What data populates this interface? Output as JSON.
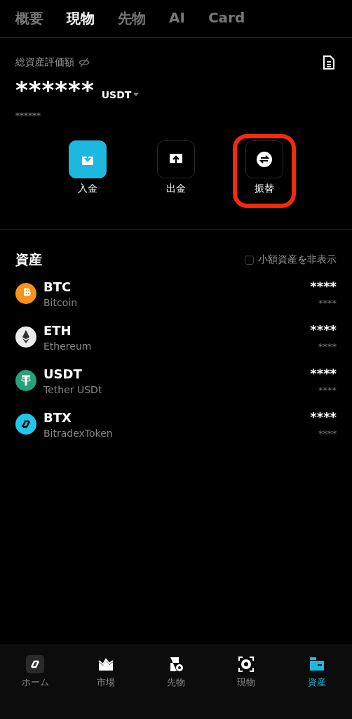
{
  "tabs": [
    {
      "label": "概要",
      "selected": false
    },
    {
      "label": "現物",
      "selected": true
    },
    {
      "label": "先物",
      "selected": false
    },
    {
      "label": "AI",
      "selected": false
    },
    {
      "label": "Card",
      "selected": false
    }
  ],
  "summary": {
    "label": "総資産評価額",
    "balance": "******",
    "currency": "USDT",
    "sub_balance": "******"
  },
  "actions": [
    {
      "kind": "deposit",
      "label": "入金",
      "highlighted": false
    },
    {
      "kind": "withdraw",
      "label": "出金",
      "highlighted": false
    },
    {
      "kind": "transfer",
      "label": "振替",
      "highlighted": true
    }
  ],
  "assets": {
    "title": "資産",
    "hide_small": {
      "label": "小額資産を非表示",
      "checked": false
    },
    "items": [
      {
        "symbol": "BTC",
        "name": "Bitcoin",
        "amount": "****",
        "value": "****",
        "color": "#f7931a"
      },
      {
        "symbol": "ETH",
        "name": "Ethereum",
        "amount": "****",
        "value": "****",
        "color": "#ececec"
      },
      {
        "symbol": "USDT",
        "name": "Tether USDt",
        "amount": "****",
        "value": "****",
        "color": "#26a17b"
      },
      {
        "symbol": "BTX",
        "name": "BitradexToken",
        "amount": "****",
        "value": "****",
        "color": "#1ec8e8"
      }
    ]
  },
  "bottom_nav": [
    {
      "kind": "home",
      "label": "ホーム",
      "selected": false
    },
    {
      "kind": "market",
      "label": "市場",
      "selected": false
    },
    {
      "kind": "futures",
      "label": "先物",
      "selected": false
    },
    {
      "kind": "spot",
      "label": "現物",
      "selected": false
    },
    {
      "kind": "assets",
      "label": "資産",
      "selected": true
    }
  ]
}
